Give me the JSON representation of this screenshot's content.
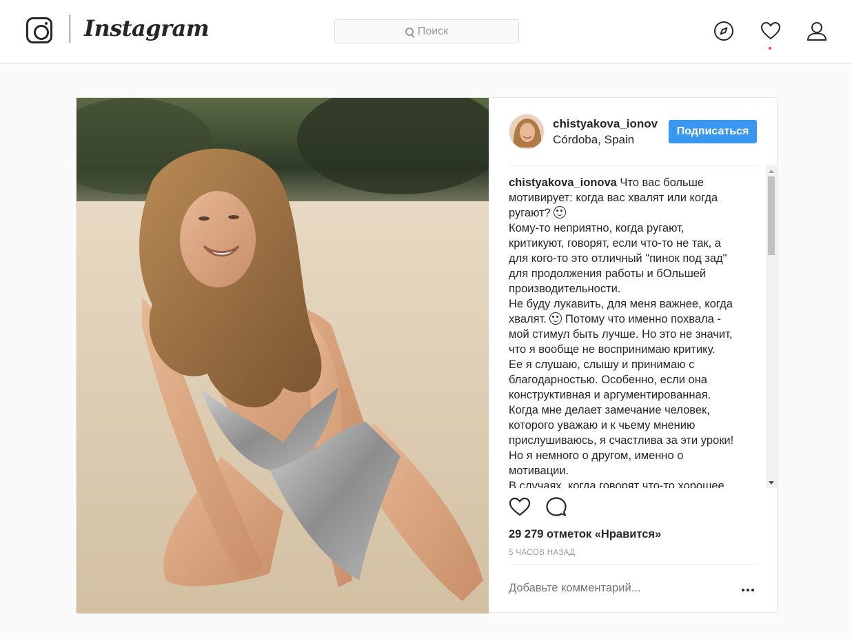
{
  "header": {
    "wordmark": "Instagram",
    "search_placeholder": "Поиск"
  },
  "post": {
    "username": "chistyakova_ionov",
    "location": "Córdoba, Spain",
    "follow_label": "Подписаться",
    "caption_user": "chistyakova_ionova",
    "caption_lines": [
      "Что вас больше",
      "мотивирует: когда вас хвалят или когда",
      "ругают? ",
      "Кому-то неприятно, когда ругают,",
      "критикуют, говорят, если что-то не так, а",
      "для кого-то это отличный \"пинок под зад\"",
      "для продолжения работы и бОльшей",
      "производительности.",
      "Не буду лукавить, для меня важнее, когда",
      "хвалят. ",
      " Потому что именно похвала -",
      "мой стимул быть лучше. Но это не значит,",
      "что я вообще не воспринимаю критику.",
      "Ее я слушаю, слышу и принимаю с",
      "благодарностью. Особенно, если она",
      "конструктивная и аргументированная.",
      "Когда мне делает замечание человек,",
      "которого уважаю и к чьему мнению",
      "прислушиваюсь, я счастлива за эти уроки!",
      "Но я немного о другом, именно о",
      "мотивации.",
      "В случаях, когда говорят что-то хорошее"
    ],
    "likes": "29 279 отметок «Нравится»",
    "timestamp": "5 ЧАСОВ НАЗАД",
    "comment_placeholder": "Добавьте комментарий..."
  },
  "colors": {
    "accent": "#3897f0",
    "notification": "#ed4956",
    "text": "#262626",
    "muted": "#999999"
  },
  "icons": [
    "compass-icon",
    "heart-icon",
    "profile-icon",
    "search-icon",
    "like-icon",
    "comment-icon",
    "more-icon",
    "emoji-icon"
  ]
}
